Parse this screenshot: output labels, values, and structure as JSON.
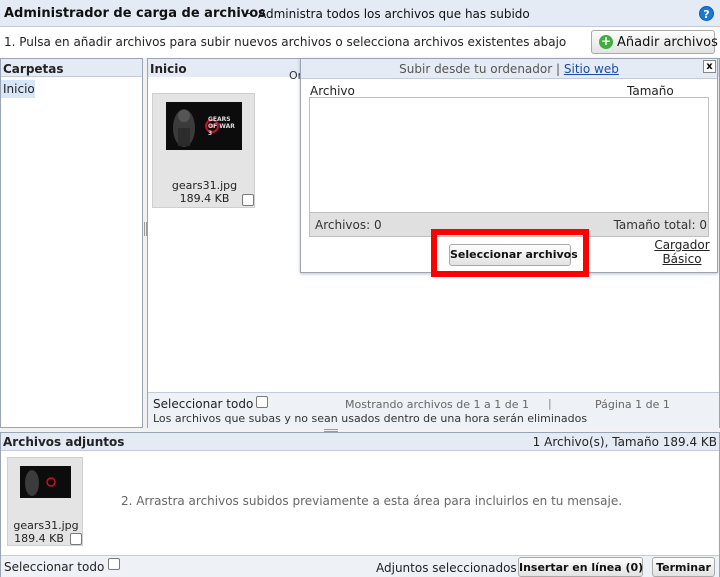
{
  "header": {
    "title": "Administrador de carga de archivos",
    "separator": "-",
    "subtitle": "Administra todos los archivos que has subido",
    "help_symbol": "?"
  },
  "toolbar": {
    "instruction": "1. Pulsa en añadir archivos para subir nuevos archivos o selecciona archivos existentes abajo",
    "add_button_label": "Añadir archivos",
    "add_icon_symbol": "+"
  },
  "folders": {
    "heading": "Carpetas",
    "items": [
      {
        "label": "Inicio"
      }
    ]
  },
  "files": {
    "heading": "Inicio",
    "order_label_fragment": "Or",
    "items": [
      {
        "name": "gears31.jpg",
        "size": "189.4 KB",
        "logo_text": "GEARS OF WAR 3"
      }
    ],
    "footer": {
      "select_all": "Seleccionar todo",
      "showing": "Mostrando archivos de 1 a 1 de 1",
      "divider": "|",
      "page": "Página 1 de 1",
      "notice": "Los archivos que subas y no sean usados dentro de una hora serán eliminados"
    }
  },
  "upload_dialog": {
    "title_text": "Subir desde tu ordenador",
    "title_sep": "|",
    "title_link": "Sitio web",
    "close_symbol": "x",
    "col_file": "Archivo",
    "col_size": "Tamaño",
    "count_label": "Archivos: 0",
    "total_size_label": "Tamaño total: 0",
    "select_button": "Seleccionar archivos",
    "basic_loader_line1": "Cargador",
    "basic_loader_line2": "Básico"
  },
  "attachments": {
    "heading": "Archivos adjuntos",
    "summary": "1 Archivo(s), Tamaño 189.4 KB",
    "items": [
      {
        "name": "gears31.jpg",
        "size": "189.4 KB"
      }
    ],
    "drop_hint": "2. Arrastra archivos subidos previamente a esta área para incluirlos en tu mensaje.",
    "footer": {
      "select_all": "Seleccionar todo",
      "selected_label": "Adjuntos seleccionados:",
      "insert_button": "Insertar en línea (0)",
      "finish_button": "Terminar"
    }
  },
  "colors": {
    "header_bg": "#e5ebf5",
    "highlight": "#ff0000",
    "add_icon": "#3fae3f",
    "help_icon": "#1b79d6"
  }
}
